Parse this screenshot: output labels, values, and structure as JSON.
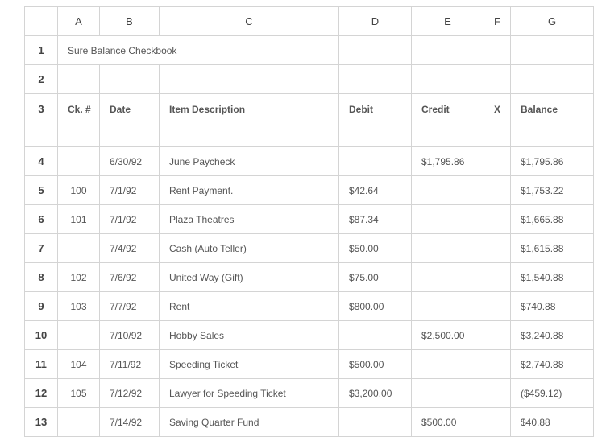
{
  "columns": [
    "A",
    "B",
    "C",
    "D",
    "E",
    "F",
    "G"
  ],
  "title": "Sure Balance Checkbook",
  "row_numbers": [
    "1",
    "2",
    "3",
    "4",
    "5",
    "6",
    "7",
    "8",
    "9",
    "10",
    "11",
    "12",
    "13"
  ],
  "header": {
    "ck": "Ck. #",
    "date": "Date",
    "item": "Item Description",
    "debit": "Debit",
    "credit": "Credit",
    "x": "X",
    "balance": "Balance"
  },
  "rows": [
    {
      "ck": "",
      "date": "6/30/92",
      "item": "June Paycheck",
      "debit": "",
      "credit": "$1,795.86",
      "x": "",
      "balance": "$1,795.86"
    },
    {
      "ck": "100",
      "date": "7/1/92",
      "item": "Rent Payment.",
      "debit": "$42.64",
      "credit": "",
      "x": "",
      "balance": "$1,753.22"
    },
    {
      "ck": "101",
      "date": "7/1/92",
      "item": "Plaza Theatres",
      "debit": "$87.34",
      "credit": "",
      "x": "",
      "balance": "$1,665.88"
    },
    {
      "ck": "",
      "date": "7/4/92",
      "item": "Cash (Auto Teller)",
      "debit": "$50.00",
      "credit": "",
      "x": "",
      "balance": "$1,615.88"
    },
    {
      "ck": "102",
      "date": "7/6/92",
      "item": "United Way (Gift)",
      "debit": "$75.00",
      "credit": "",
      "x": "",
      "balance": "$1,540.88"
    },
    {
      "ck": "103",
      "date": "7/7/92",
      "item": "Rent",
      "debit": "$800.00",
      "credit": "",
      "x": "",
      "balance": "$740.88"
    },
    {
      "ck": "",
      "date": "7/10/92",
      "item": "Hobby Sales",
      "debit": "",
      "credit": "$2,500.00",
      "x": "",
      "balance": "$3,240.88"
    },
    {
      "ck": "104",
      "date": "7/11/92",
      "item": "Speeding Ticket",
      "debit": "$500.00",
      "credit": "",
      "x": "",
      "balance": "$2,740.88"
    },
    {
      "ck": "105",
      "date": "7/12/92",
      "item": "Lawyer for Speeding Ticket",
      "debit": "$3,200.00",
      "credit": "",
      "x": "",
      "balance": "($459.12)"
    },
    {
      "ck": "",
      "date": "7/14/92",
      "item": "Saving Quarter Fund",
      "debit": "",
      "credit": "$500.00",
      "x": "",
      "balance": "$40.88"
    }
  ]
}
